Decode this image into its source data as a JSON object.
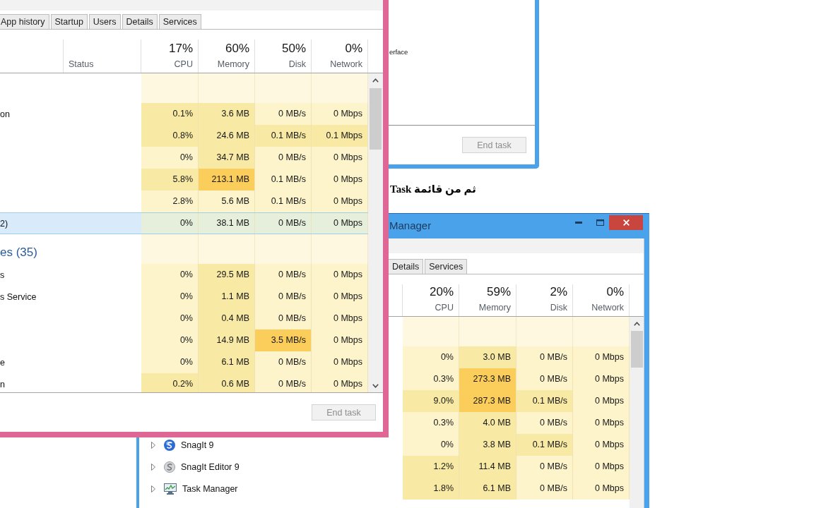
{
  "background_window": {
    "rows": [
      {
        "name": "erface"
      }
    ],
    "end_task": {
      "label": "End task",
      "disabled": true
    }
  },
  "instruction_text": "ثم من قائمة Task",
  "lower_window": {
    "title": "Manager",
    "tabs": [
      {
        "label": "Details",
        "selected": false
      },
      {
        "label": "Services",
        "selected": false
      }
    ],
    "columns": [
      {
        "percent": "20%",
        "label": "CPU"
      },
      {
        "percent": "59%",
        "label": "Memory"
      },
      {
        "percent": "2%",
        "label": "Disk"
      },
      {
        "percent": "0%",
        "label": "Network"
      }
    ],
    "rows": [
      {
        "kind": "group"
      },
      {
        "kind": "process",
        "cells": [
          {
            "text": "0%",
            "color": "#fdf4cc"
          },
          {
            "text": "3.0 MB",
            "color": "#f8e9a4"
          },
          {
            "text": "0 MB/s",
            "color": "#fdf4cc"
          },
          {
            "text": "0 Mbps",
            "color": "#fdf4cc"
          }
        ]
      },
      {
        "kind": "process",
        "cells": [
          {
            "text": "0.3%",
            "color": "#fdf4cc"
          },
          {
            "text": "273.3 MB",
            "color": "#fbcd5a"
          },
          {
            "text": "0 MB/s",
            "color": "#fdf4cc"
          },
          {
            "text": "0 Mbps",
            "color": "#fdf4cc"
          }
        ]
      },
      {
        "kind": "process",
        "cells": [
          {
            "text": "9.0%",
            "color": "#f8e9a4"
          },
          {
            "text": "287.3 MB",
            "color": "#fbcd5a"
          },
          {
            "text": "0.1 MB/s",
            "color": "#f8e9a4"
          },
          {
            "text": "0 Mbps",
            "color": "#fdf4cc"
          }
        ]
      },
      {
        "kind": "process",
        "cells": [
          {
            "text": "0.3%",
            "color": "#fdf4cc"
          },
          {
            "text": "4.0 MB",
            "color": "#f8e9a4"
          },
          {
            "text": "0 MB/s",
            "color": "#fdf4cc"
          },
          {
            "text": "0 Mbps",
            "color": "#fdf4cc"
          }
        ]
      },
      {
        "kind": "process",
        "name": "SnagIt 9",
        "expanded": false,
        "cells": [
          {
            "text": "0%",
            "color": "#fdf4cc"
          },
          {
            "text": "3.8 MB",
            "color": "#f8e9a4"
          },
          {
            "text": "0.1 MB/s",
            "color": "#f8e9a4"
          },
          {
            "text": "0 Mbps",
            "color": "#fdf4cc"
          }
        ]
      },
      {
        "kind": "process",
        "name": "SnagIt Editor 9",
        "expanded": false,
        "cells": [
          {
            "text": "1.2%",
            "color": "#f8e9a4"
          },
          {
            "text": "11.4 MB",
            "color": "#f8e9a4"
          },
          {
            "text": "0 MB/s",
            "color": "#fdf4cc"
          },
          {
            "text": "0 Mbps",
            "color": "#fdf4cc"
          }
        ]
      },
      {
        "kind": "process",
        "name": "Task Manager",
        "expanded": false,
        "cells": [
          {
            "text": "1.8%",
            "color": "#f8e9a4"
          },
          {
            "text": "6.1 MB",
            "color": "#f8e9a4"
          },
          {
            "text": "0 MB/s",
            "color": "#fdf4cc"
          },
          {
            "text": "0 Mbps",
            "color": "#fdf4cc"
          }
        ]
      }
    ]
  },
  "front_window": {
    "tabs": [
      {
        "label": "App history",
        "selected": false
      },
      {
        "label": "Startup",
        "selected": false
      },
      {
        "label": "Users",
        "selected": false
      },
      {
        "label": "Details",
        "selected": false
      },
      {
        "label": "Services",
        "selected": false
      }
    ],
    "status_label": "Status",
    "columns": [
      {
        "percent": "17%",
        "label": "CPU"
      },
      {
        "percent": "60%",
        "label": "Memory"
      },
      {
        "percent": "50%",
        "label": "Disk"
      },
      {
        "percent": "0%",
        "label": "Network"
      }
    ],
    "rows": [
      {
        "kind": "group",
        "selected": false
      },
      {
        "kind": "process",
        "name": "on",
        "selected": false,
        "cells": [
          {
            "text": "0.1%",
            "color": "#f8e9a4"
          },
          {
            "text": "3.6 MB",
            "color": "#f8e9a4"
          },
          {
            "text": "0 MB/s",
            "color": "#fdf4cc"
          },
          {
            "text": "0 Mbps",
            "color": "#fdf4cc"
          }
        ]
      },
      {
        "kind": "process",
        "selected": false,
        "cells": [
          {
            "text": "0.8%",
            "color": "#f8e9a4"
          },
          {
            "text": "24.6 MB",
            "color": "#f8e9a4"
          },
          {
            "text": "0.1 MB/s",
            "color": "#f8e9a4"
          },
          {
            "text": "0.1 Mbps",
            "color": "#f8e9a4"
          }
        ]
      },
      {
        "kind": "process",
        "selected": false,
        "cells": [
          {
            "text": "0%",
            "color": "#fdf4cc"
          },
          {
            "text": "34.7 MB",
            "color": "#f8e9a4"
          },
          {
            "text": "0 MB/s",
            "color": "#fdf4cc"
          },
          {
            "text": "0 Mbps",
            "color": "#fdf4cc"
          }
        ]
      },
      {
        "kind": "process",
        "selected": false,
        "cells": [
          {
            "text": "5.8%",
            "color": "#f8e9a4"
          },
          {
            "text": "213.1 MB",
            "color": "#fbcd5a"
          },
          {
            "text": "0.1 MB/s",
            "color": "#fdf4cc"
          },
          {
            "text": "0 Mbps",
            "color": "#fdf4cc"
          }
        ]
      },
      {
        "kind": "process",
        "selected": false,
        "cells": [
          {
            "text": "2.8%",
            "color": "#fdf4cc"
          },
          {
            "text": "5.6 MB",
            "color": "#fdf4cc"
          },
          {
            "text": "0.1 MB/s",
            "color": "#fdf4cc"
          },
          {
            "text": "0 Mbps",
            "color": "#fdf4cc"
          }
        ]
      },
      {
        "kind": "process",
        "name": "2)",
        "selected": true,
        "cells": [
          {
            "text": "0%",
            "color": "#e6efdc"
          },
          {
            "text": "38.1 MB",
            "color": "#e6efdc"
          },
          {
            "text": "0 MB/s",
            "color": "#e6efdc"
          },
          {
            "text": "0 Mbps",
            "color": "#e6efdc"
          }
        ]
      },
      {
        "kind": "group",
        "name": "es (35)",
        "selected": false
      },
      {
        "kind": "process",
        "name": "s",
        "selected": false,
        "cells": [
          {
            "text": "0%",
            "color": "#fdf4cc"
          },
          {
            "text": "29.5 MB",
            "color": "#f8e9a4"
          },
          {
            "text": "0 MB/s",
            "color": "#fdf4cc"
          },
          {
            "text": "0 Mbps",
            "color": "#fdf4cc"
          }
        ]
      },
      {
        "kind": "process",
        "name": "s Service",
        "selected": false,
        "cells": [
          {
            "text": "0%",
            "color": "#fdf4cc"
          },
          {
            "text": "1.1 MB",
            "color": "#f8e9a4"
          },
          {
            "text": "0 MB/s",
            "color": "#fdf4cc"
          },
          {
            "text": "0 Mbps",
            "color": "#fdf4cc"
          }
        ]
      },
      {
        "kind": "process",
        "selected": false,
        "cells": [
          {
            "text": "0%",
            "color": "#fdf4cc"
          },
          {
            "text": "0.4 MB",
            "color": "#f8e9a4"
          },
          {
            "text": "0 MB/s",
            "color": "#fdf4cc"
          },
          {
            "text": "0 Mbps",
            "color": "#fdf4cc"
          }
        ]
      },
      {
        "kind": "process",
        "selected": false,
        "cells": [
          {
            "text": "0%",
            "color": "#fdf4cc"
          },
          {
            "text": "14.9 MB",
            "color": "#f8e9a4"
          },
          {
            "text": "3.5 MB/s",
            "color": "#fbcd5a"
          },
          {
            "text": "0 Mbps",
            "color": "#fdf4cc"
          }
        ]
      },
      {
        "kind": "process",
        "name": "e",
        "selected": false,
        "cells": [
          {
            "text": "0%",
            "color": "#fdf4cc"
          },
          {
            "text": "6.1 MB",
            "color": "#f8e9a4"
          },
          {
            "text": "0 MB/s",
            "color": "#fdf4cc"
          },
          {
            "text": "0 Mbps",
            "color": "#fdf4cc"
          }
        ]
      },
      {
        "kind": "process",
        "name": "n",
        "selected": false,
        "cells": [
          {
            "text": "0.2%",
            "color": "#f8e9a4"
          },
          {
            "text": "0.6 MB",
            "color": "#f8e9a4"
          },
          {
            "text": "0 MB/s",
            "color": "#fdf4cc"
          },
          {
            "text": "0 Mbps",
            "color": "#fdf4cc"
          }
        ]
      }
    ],
    "end_task": {
      "label": "End task",
      "disabled": true
    }
  }
}
